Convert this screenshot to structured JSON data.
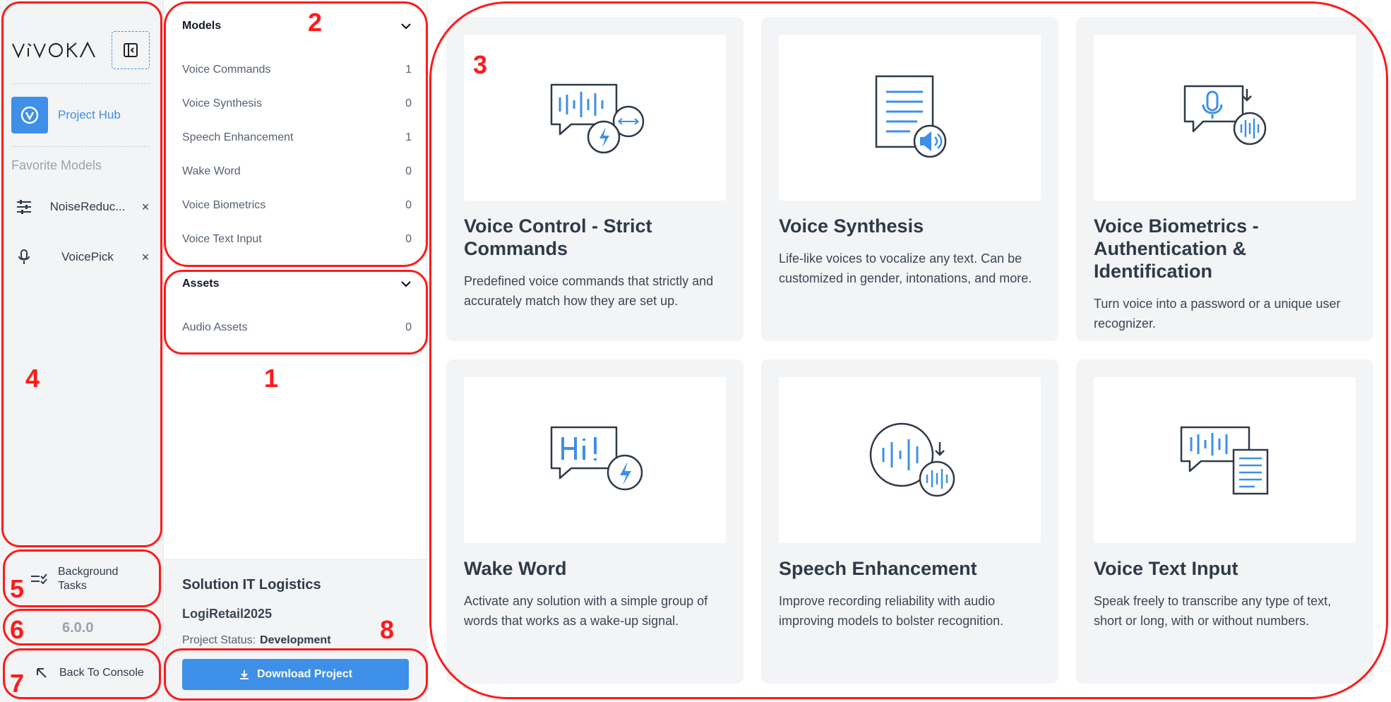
{
  "rail": {
    "logo": "VIVOKA",
    "project_hub": "Project Hub",
    "favorites_title": "Favorite Models",
    "favorites": [
      {
        "label": "NoiseReduc...",
        "icon": "sliders-icon"
      },
      {
        "label": "VoicePick",
        "icon": "microphone-icon"
      }
    ],
    "close_glyph": "×",
    "background_tasks": "Background Tasks",
    "version": "6.0.0",
    "back_to_console": "Back To Console"
  },
  "panel": {
    "models_title": "Models",
    "models": [
      {
        "label": "Voice Commands",
        "count": "1"
      },
      {
        "label": "Voice Synthesis",
        "count": "0"
      },
      {
        "label": "Speech Enhancement",
        "count": "1"
      },
      {
        "label": "Wake Word",
        "count": "0"
      },
      {
        "label": "Voice Biometrics",
        "count": "0"
      },
      {
        "label": "Voice Text Input",
        "count": "0"
      }
    ],
    "assets_title": "Assets",
    "assets": [
      {
        "label": "Audio Assets",
        "count": "0"
      }
    ],
    "project": {
      "name": "Solution IT Logistics",
      "code": "LogiRetail2025",
      "status_label": "Project Status:",
      "status_value": "Development",
      "download": "Download Project"
    }
  },
  "cards": [
    {
      "title": "Voice Control - Strict Commands",
      "desc": "Predefined voice commands that strictly and accurately match how they are set up.",
      "icon": "voice-command-icon"
    },
    {
      "title": "Voice Synthesis",
      "desc": "Life-like voices to vocalize any text. Can be customized in gender, intonations, and more.",
      "icon": "voice-synthesis-icon"
    },
    {
      "title": "Voice Biometrics - Authentication & Identification",
      "desc": "Turn voice into a password or a unique user recognizer.",
      "icon": "voice-biometrics-icon"
    },
    {
      "title": "Wake Word",
      "desc": "Activate any solution with a simple group of words that works as a wake-up signal.",
      "icon": "wake-word-icon"
    },
    {
      "title": "Speech Enhancement",
      "desc": "Improve recording reliability with audio improving models to bolster recognition.",
      "icon": "speech-enhancement-icon"
    },
    {
      "title": "Voice Text Input",
      "desc": "Speak freely to transcribe any type of text, short or long, with or without numbers.",
      "icon": "voice-text-input-icon"
    }
  ],
  "annotations": [
    "1",
    "2",
    "3",
    "4",
    "5",
    "6",
    "7",
    "8"
  ],
  "colors": {
    "accent": "#3d8fe8",
    "annotation": "#ff1a1a",
    "rail_bg": "#f3f4f6"
  }
}
